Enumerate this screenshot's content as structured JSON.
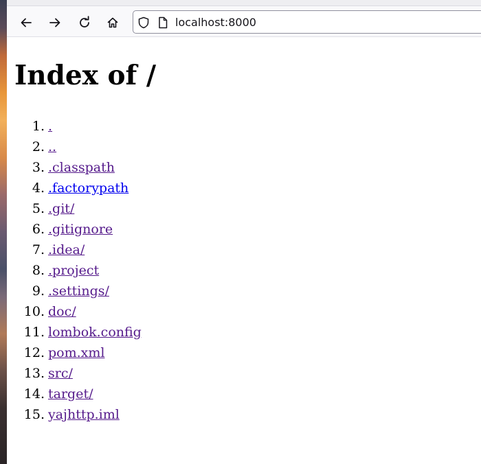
{
  "browser": {
    "url": "localhost:8000",
    "nav": {
      "back_icon": "arrow-left-icon",
      "forward_icon": "arrow-right-icon",
      "reload_icon": "reload-icon",
      "home_icon": "home-icon"
    }
  },
  "page": {
    "title": "Index of /",
    "entries": [
      {
        "num": "1.",
        "name": ".",
        "visited": true
      },
      {
        "num": "2.",
        "name": "..",
        "visited": true
      },
      {
        "num": "3.",
        "name": ".classpath",
        "visited": true
      },
      {
        "num": "4.",
        "name": ".factorypath",
        "visited": false
      },
      {
        "num": "5.",
        "name": ".git/",
        "visited": true
      },
      {
        "num": "6.",
        "name": ".gitignore",
        "visited": true
      },
      {
        "num": "7.",
        "name": ".idea/",
        "visited": true
      },
      {
        "num": "8.",
        "name": ".project",
        "visited": true
      },
      {
        "num": "9.",
        "name": ".settings/",
        "visited": true
      },
      {
        "num": "10.",
        "name": "doc/",
        "visited": true
      },
      {
        "num": "11.",
        "name": "lombok.config",
        "visited": true
      },
      {
        "num": "12.",
        "name": "pom.xml",
        "visited": true
      },
      {
        "num": "13.",
        "name": "src/",
        "visited": true
      },
      {
        "num": "14.",
        "name": "target/",
        "visited": true
      },
      {
        "num": "15.",
        "name": "yajhttp.iml",
        "visited": true
      }
    ]
  },
  "colors": {
    "visited_link": "#551a8b",
    "unvisited_link": "#0000ee"
  }
}
